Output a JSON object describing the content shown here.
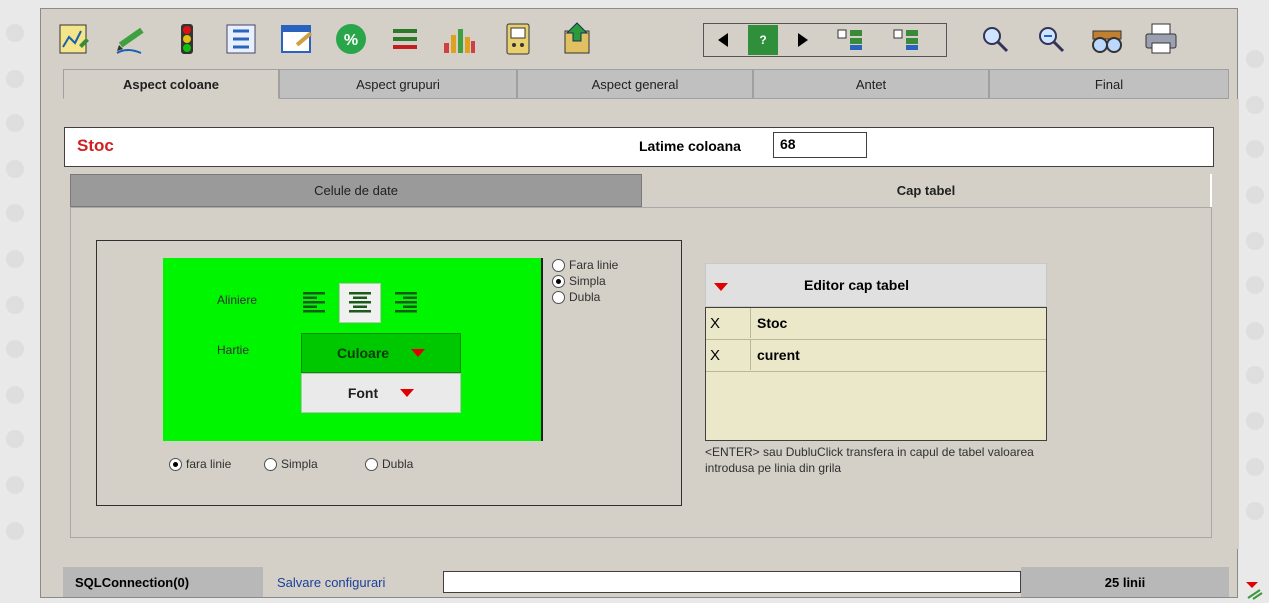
{
  "toolbar": {
    "icons": [
      "report-edit-icon",
      "pen-edit-icon",
      "traffic-light-icon",
      "tree-filter-icon",
      "calendar-edit-icon",
      "percent-icon",
      "lines-icon",
      "chart-people-icon",
      "printer-device-icon",
      "export-icon"
    ],
    "nav": {
      "help_label": "?"
    },
    "right_icons": [
      "search-icon",
      "search-advanced-icon",
      "binoculars-icon",
      "print-icon"
    ]
  },
  "tabs": [
    {
      "label": "Aspect coloane",
      "active": true
    },
    {
      "label": "Aspect grupuri",
      "active": false
    },
    {
      "label": "Aspect general",
      "active": false
    },
    {
      "label": "Antet",
      "active": false
    },
    {
      "label": "Final",
      "active": false
    }
  ],
  "column": {
    "title": "Stoc",
    "width_label": "Latime coloana",
    "width_value": "68"
  },
  "subtabs": [
    {
      "label": "Celule de date",
      "active": false
    },
    {
      "label": "Cap tabel",
      "active": true
    }
  ],
  "format": {
    "align_label": "Aliniere",
    "paper_label": "Hartie",
    "color_button": "Culoare",
    "font_button": "Font",
    "selected_alignment": "center",
    "side_border_options": [
      "Fara linie",
      "Simpla",
      "Dubla"
    ],
    "side_border_selected": "Simpla",
    "bottom_border_options": [
      "fara linie",
      "Simpla",
      "Dubla"
    ],
    "bottom_border_selected": "fara linie",
    "background_color": "#00f500"
  },
  "editor": {
    "title": "Editor cap tabel",
    "rows": [
      {
        "mark": "X",
        "value": "Stoc"
      },
      {
        "mark": "X",
        "value": "curent"
      }
    ],
    "note": "<ENTER> sau DubluClick transfera in capul de tabel valoarea introdusa pe linia din grila"
  },
  "status": {
    "connection": "SQLConnection(0)",
    "save_link": "Salvare configurari",
    "input_value": "",
    "count": "25 linii"
  }
}
